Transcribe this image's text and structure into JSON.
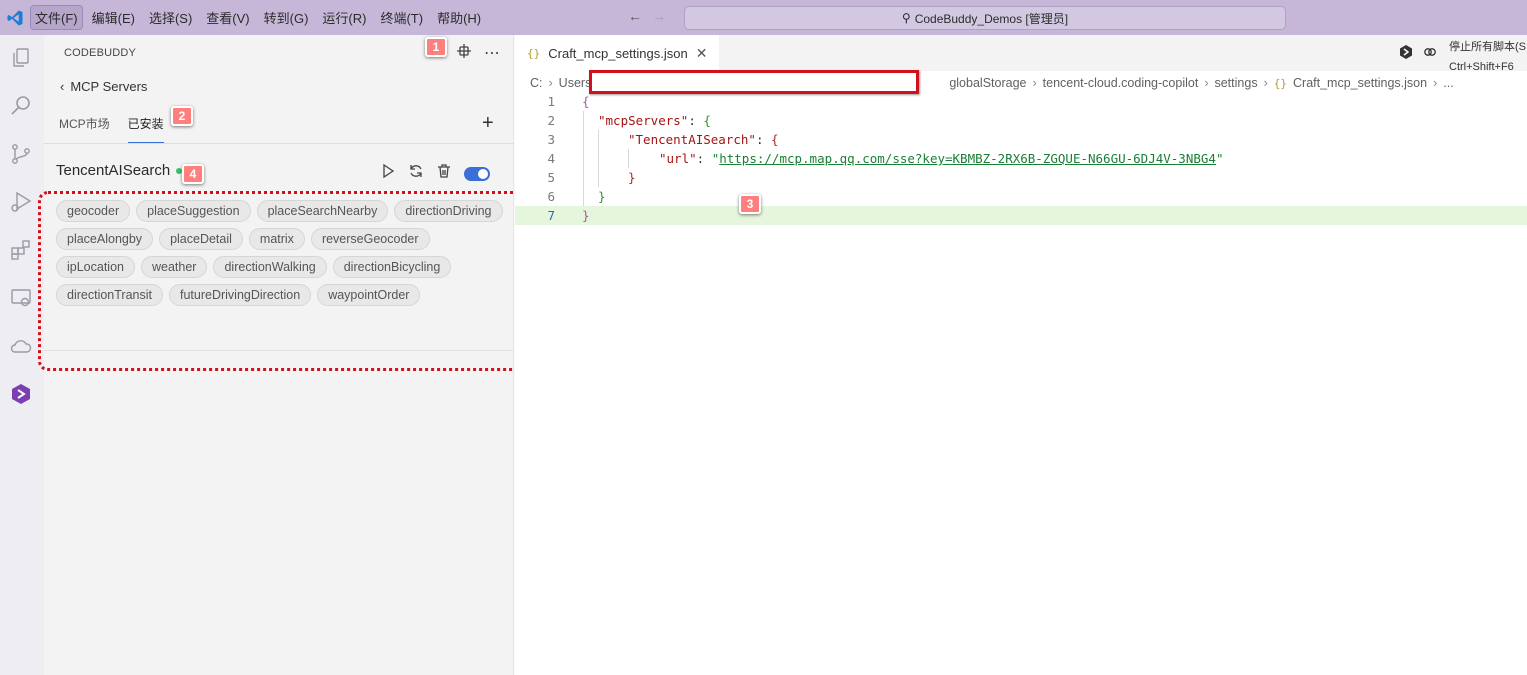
{
  "titlebar": {
    "menus": [
      "文件(F)",
      "编辑(E)",
      "选择(S)",
      "查看(V)",
      "转到(G)",
      "运行(R)",
      "终端(T)",
      "帮助(H)"
    ],
    "search_text": "CodeBuddy_Demos [管理员]"
  },
  "sidebar": {
    "title": "CODEBUDDY",
    "back_label": "MCP Servers",
    "tabs": [
      "MCP市场",
      "已安装"
    ],
    "active_tab": "已安装",
    "server": {
      "name": "TencentAISearch",
      "status_color": "#3cbf6b",
      "enabled": true,
      "tools": [
        "geocoder",
        "placeSuggestion",
        "placeSearchNearby",
        "directionDriving",
        "placeAlongby",
        "placeDetail",
        "matrix",
        "reverseGeocoder",
        "ipLocation",
        "weather",
        "directionWalking",
        "directionBicycling",
        "directionTransit",
        "futureDrivingDirection",
        "waypointOrder"
      ]
    }
  },
  "editor": {
    "tab_label": "Craft_mcp_settings.json",
    "hint_top": "停止所有脚本(S",
    "hint_bottom": "Ctrl+Shift+F6",
    "breadcrumb": {
      "drive": "C:",
      "users": "Users",
      "global_storage": "globalStorage",
      "extension": "tencent-cloud.coding-copilot",
      "settings": "settings",
      "file": "Craft_mcp_settings.json",
      "more": "..."
    },
    "code": {
      "key_servers": "\"mcpServers\"",
      "key_server": "\"TencentAISearch\"",
      "key_url": "\"url\"",
      "url": "https://mcp.map.qq.com/sse?key=KBMBZ-2RX6B-ZGQUE-N66GU-6DJ4V-3NBG4"
    },
    "line_numbers": [
      "1",
      "2",
      "3",
      "4",
      "5",
      "6",
      "7"
    ]
  },
  "annotations": [
    "1",
    "2",
    "3",
    "4"
  ],
  "colors": {
    "titlebar": "#c6b7d8",
    "accent": "#3b6fd8",
    "annotation_red": "#d0101a",
    "badge": "#ff7f7f"
  }
}
